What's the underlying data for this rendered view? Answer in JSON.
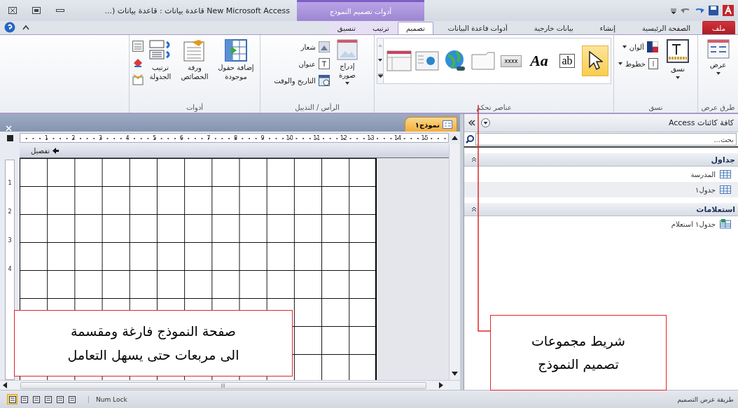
{
  "title_bar": {
    "title": "New Microsoft Access قاعدة بيانات : قاعدة بيانات (...",
    "context_title": "أدوات تصميم النموذج"
  },
  "tabs": [
    {
      "label": "ملف",
      "kind": "file",
      "selected": false
    },
    {
      "label": "الصفحة الرئيسية",
      "kind": "main",
      "selected": false
    },
    {
      "label": "إنشاء",
      "kind": "main",
      "selected": false
    },
    {
      "label": "بيانات خارجية",
      "kind": "main",
      "selected": false
    },
    {
      "label": "أدوات قاعدة البيانات",
      "kind": "main",
      "selected": false
    },
    {
      "label": "تصميم",
      "kind": "context",
      "selected": true
    },
    {
      "label": "ترتيب",
      "kind": "context",
      "selected": false
    },
    {
      "label": "تنسيق",
      "kind": "context",
      "selected": false
    }
  ],
  "ribbon": {
    "groups": [
      {
        "label": "طرق عرض",
        "kind": "views",
        "items": [
          {
            "label": "عرض"
          }
        ]
      },
      {
        "label": "نسق",
        "kind": "themes",
        "items": [
          {
            "label": "نسق"
          },
          {
            "label": "ألوان"
          },
          {
            "label": "خطوط"
          }
        ]
      },
      {
        "label": "عناصر تحكم",
        "kind": "controls",
        "items": [
          {
            "kind": "pointer",
            "selected": true
          },
          {
            "kind": "textbox",
            "label": "ab",
            "selected": false
          },
          {
            "kind": "label",
            "label": "Aa",
            "selected": false
          },
          {
            "kind": "button",
            "label": "xxxx",
            "selected": false
          },
          {
            "kind": "tab",
            "selected": false
          },
          {
            "kind": "hyperlink",
            "selected": false
          },
          {
            "kind": "browser",
            "selected": false
          },
          {
            "kind": "navigation",
            "selected": false
          }
        ]
      },
      {
        "label": "الرأس / التذييل",
        "kind": "header_footer",
        "items": [
          {
            "label": "إدراج صورة"
          },
          {
            "label": "شعار"
          },
          {
            "label": "عنوان"
          },
          {
            "label": "التاريخ والوقت"
          }
        ]
      },
      {
        "label": "أدوات",
        "kind": "tools",
        "items": [
          {
            "label": "إضافة حقول موجودة"
          },
          {
            "label": "ورقة الخصائص"
          },
          {
            "label": "ترتيب الجدولة"
          }
        ]
      }
    ]
  },
  "form": {
    "tab_label": "نموذج١",
    "ruler": [
      "15",
      "14",
      "13",
      "12",
      "11",
      "10",
      "9",
      "8",
      "7",
      "6",
      "5",
      "4",
      "3",
      "2",
      "1"
    ],
    "vertical_ruler": [
      "1",
      "2",
      "3",
      "4"
    ],
    "section": "تفصيل"
  },
  "navigation_pane": {
    "title": "كافة كائنات Access",
    "search_placeholder": "بحث...",
    "groups": [
      {
        "label": "جداول",
        "items": [
          {
            "label": "المدرسة",
            "kind": "table"
          },
          {
            "label": "جدول١",
            "kind": "table"
          }
        ]
      },
      {
        "label": "استعلامات",
        "items": [
          {
            "label": "جدول١ استعلام",
            "kind": "query"
          }
        ]
      }
    ]
  },
  "status_bar": {
    "view_buttons": [
      {
        "selected": true
      },
      {
        "selected": false
      },
      {
        "selected": false
      },
      {
        "selected": false
      },
      {
        "selected": false
      },
      {
        "selected": false
      }
    ],
    "indicator": "Num Lock",
    "view_name": "طريقة عرض التصميم"
  },
  "annotations": [
    {
      "text": "صفحة النموذج فارغة ومقسمة\nالى مربعات حتى يسهل التعامل"
    },
    {
      "text": "شريط مجموعات\nتصميم النموذج"
    }
  ]
}
